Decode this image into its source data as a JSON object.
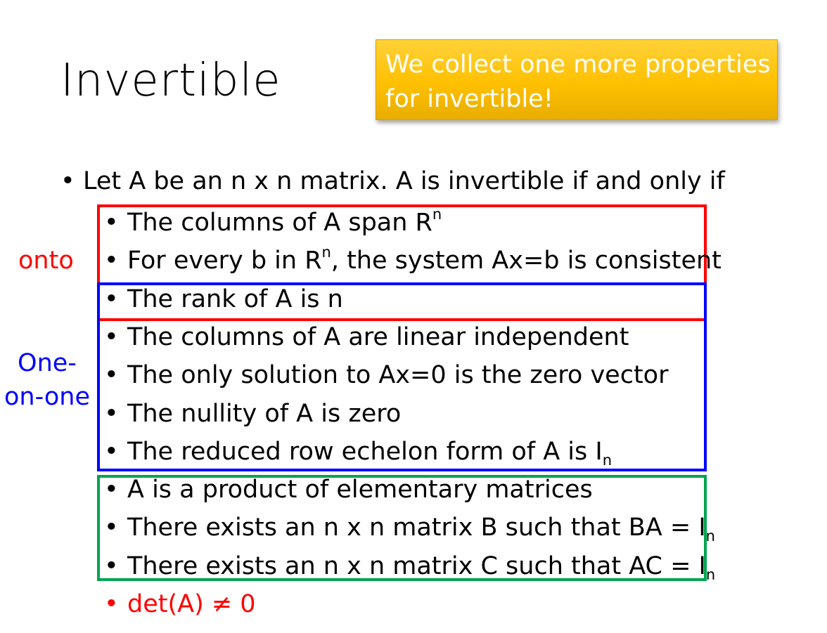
{
  "slide": {
    "title": "Invertible",
    "callout": {
      "line1": "We collect one more properties",
      "line2": "for invertible!"
    },
    "intro": "Let A be an n x n matrix. A is invertible if and only if",
    "side_labels": {
      "onto": "onto",
      "one_line1": "One-",
      "one_line2": "on-one"
    },
    "items": [
      {
        "text": "The columns of A span R",
        "sup": "n",
        "rest": ""
      },
      {
        "text": "For every b in R",
        "sup": "n",
        "rest": ", the system Ax=b is consistent"
      },
      {
        "text": "The rank of A is n"
      },
      {
        "text": "The columns of A are linear independent"
      },
      {
        "text": "The only solution to Ax=0 is the zero vector"
      },
      {
        "text": "The nullity of A is zero"
      },
      {
        "text": "The reduced row echelon form of A is I",
        "sub": "n"
      },
      {
        "text": "A is a product of elementary matrices"
      },
      {
        "text": "There exists an n x n matrix B such that BA = I",
        "sub": "n"
      },
      {
        "text": "There exists an n x n matrix C such that AC = I",
        "sub": "n"
      },
      {
        "text": "det(A) ≠  0"
      }
    ],
    "colors": {
      "callout": "#ffc000",
      "onto_box": "#ff0000",
      "one_to_one_box": "#0000ff",
      "invertible_box": "#00a550",
      "det_text": "#ff0000"
    }
  }
}
